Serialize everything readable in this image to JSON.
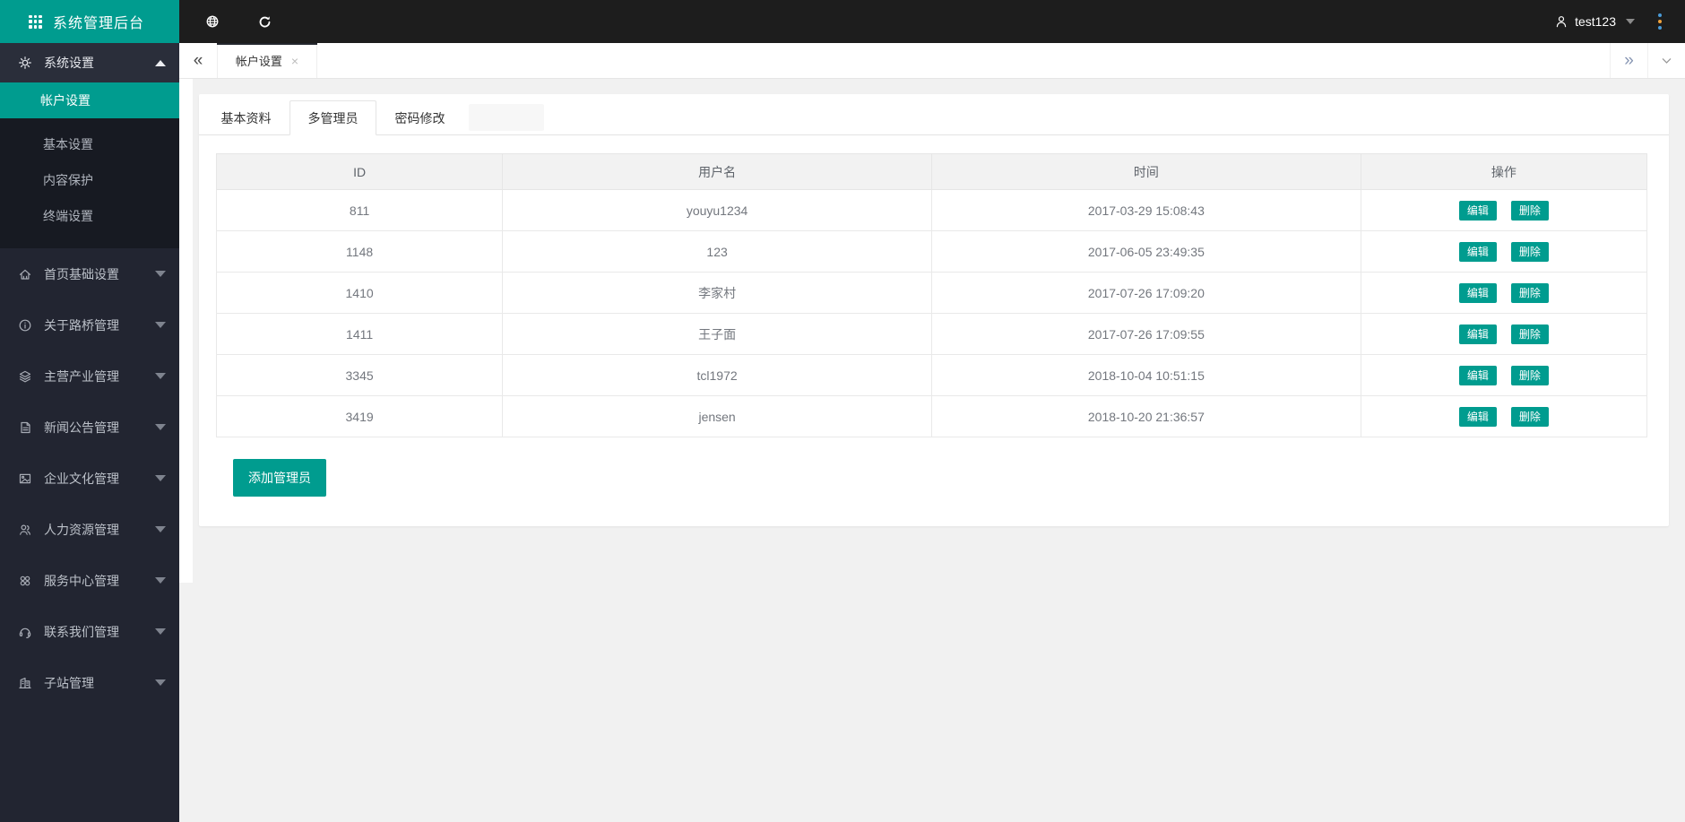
{
  "sidebar": {
    "logo": {
      "title": "系统管理后台",
      "icon": "grid-icon"
    },
    "parent": {
      "label": "系统设置",
      "icon": "gear-icon"
    },
    "active_item": "帐户设置",
    "submenu": [
      {
        "label": "基本设置"
      },
      {
        "label": "内容保护"
      },
      {
        "label": "终端设置"
      }
    ],
    "items": [
      {
        "label": "首页基础设置",
        "icon": "home-icon"
      },
      {
        "label": "关于路桥管理",
        "icon": "info-icon"
      },
      {
        "label": "主营产业管理",
        "icon": "layers-icon"
      },
      {
        "label": "新闻公告管理",
        "icon": "news-icon"
      },
      {
        "label": "企业文化管理",
        "icon": "image-icon"
      },
      {
        "label": "人力资源管理",
        "icon": "people-icon"
      },
      {
        "label": "服务中心管理",
        "icon": "service-icon"
      },
      {
        "label": "联系我们管理",
        "icon": "headset-icon"
      },
      {
        "label": "子站管理",
        "icon": "building-icon"
      }
    ]
  },
  "topbar": {
    "icons": [
      "globe-icon",
      "refresh-icon",
      "user-icon",
      "kebab-icon"
    ],
    "username": "test123"
  },
  "tabbar": {
    "active_tab": "帐户设置",
    "close_glyph": "×",
    "collapse_glyph": "«",
    "expand_glyph": "»"
  },
  "panel": {
    "tabs": [
      {
        "label": "基本资料",
        "active": false
      },
      {
        "label": "多管理员",
        "active": true
      },
      {
        "label": "密码修改",
        "active": false
      }
    ],
    "table": {
      "headers": [
        "ID",
        "用户名",
        "时间",
        "操作"
      ],
      "rows": [
        {
          "id": "811",
          "username": "youyu1234",
          "time": "2017-03-29 15:08:43"
        },
        {
          "id": "1148",
          "username": "123",
          "time": "2017-06-05 23:49:35"
        },
        {
          "id": "1410",
          "username": "李家村",
          "time": "2017-07-26 17:09:20"
        },
        {
          "id": "1411",
          "username": "王子面",
          "time": "2017-07-26 17:09:55"
        },
        {
          "id": "3345",
          "username": "tcl1972",
          "time": "2018-10-04 10:51:15"
        },
        {
          "id": "3419",
          "username": "jensen",
          "time": "2018-10-20 21:36:57"
        }
      ],
      "edit_label": "编辑",
      "delete_label": "删除"
    },
    "add_button": "添加管理员"
  },
  "colors": {
    "accent_teal": "#009c8f",
    "sidebar_bg": "#222531",
    "submenu_bg": "#171a22",
    "topbar_bg": "#1d1d1d",
    "content_bg": "#f1f1f1",
    "table_header_bg": "#f2f2f2"
  }
}
